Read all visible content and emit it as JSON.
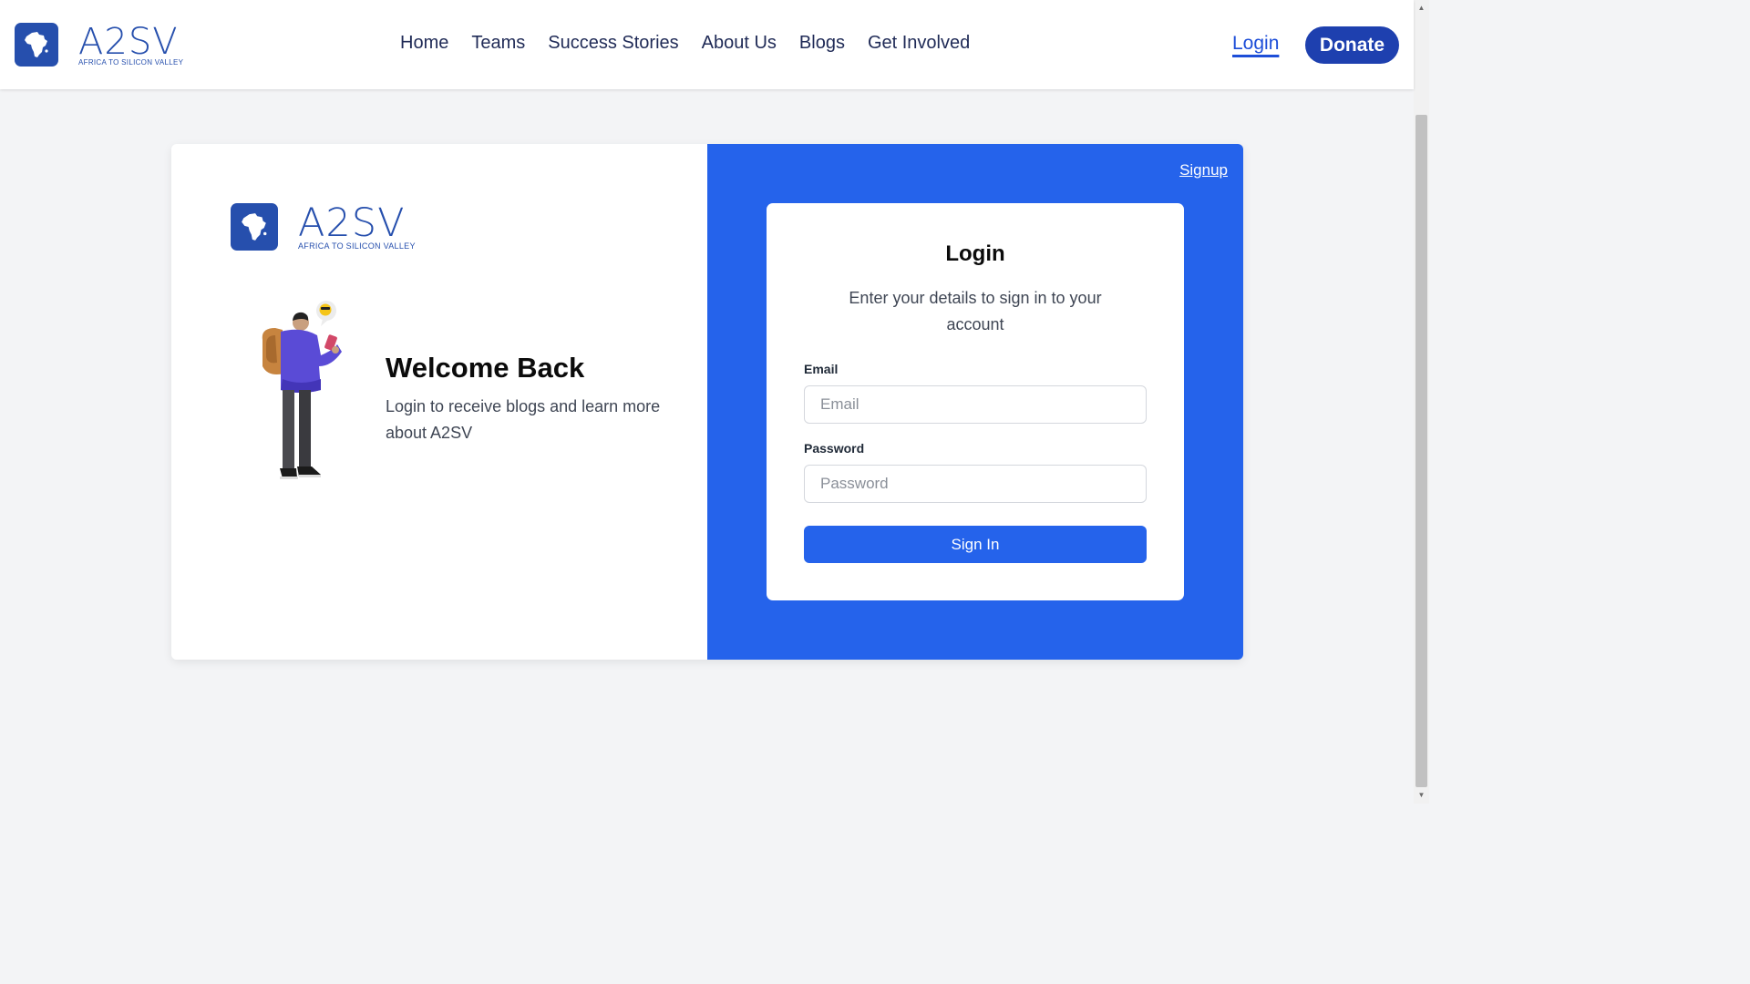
{
  "header": {
    "logo": {
      "wordmark": "A2SV",
      "tagline": "AFRICA TO SILICON VALLEY"
    },
    "nav": [
      {
        "label": "Home"
      },
      {
        "label": "Teams"
      },
      {
        "label": "Success Stories"
      },
      {
        "label": "About Us"
      },
      {
        "label": "Blogs"
      },
      {
        "label": "Get Involved"
      }
    ],
    "login_label": "Login",
    "donate_label": "Donate"
  },
  "left": {
    "logo": {
      "wordmark": "A2SV",
      "tagline": "AFRICA TO SILICON VALLEY"
    },
    "welcome_title": "Welcome Back",
    "welcome_text": "Login to receive blogs and learn more about A2SV"
  },
  "right": {
    "signup_label": "Signup",
    "form": {
      "title": "Login",
      "subtitle": "Enter your details to sign in to your account",
      "email_label": "Email",
      "email_placeholder": "Email",
      "email_value": "",
      "password_label": "Password",
      "password_placeholder": "Password",
      "password_value": "",
      "submit_label": "Sign In"
    }
  },
  "colors": {
    "brand_blue": "#264fad",
    "panel_blue": "#2563eb",
    "donate_blue": "#1e40af",
    "page_bg": "#f3f4f6"
  },
  "icons": {
    "logo": "africa-map-icon",
    "illustration": "traveler-with-phone-illustration"
  }
}
